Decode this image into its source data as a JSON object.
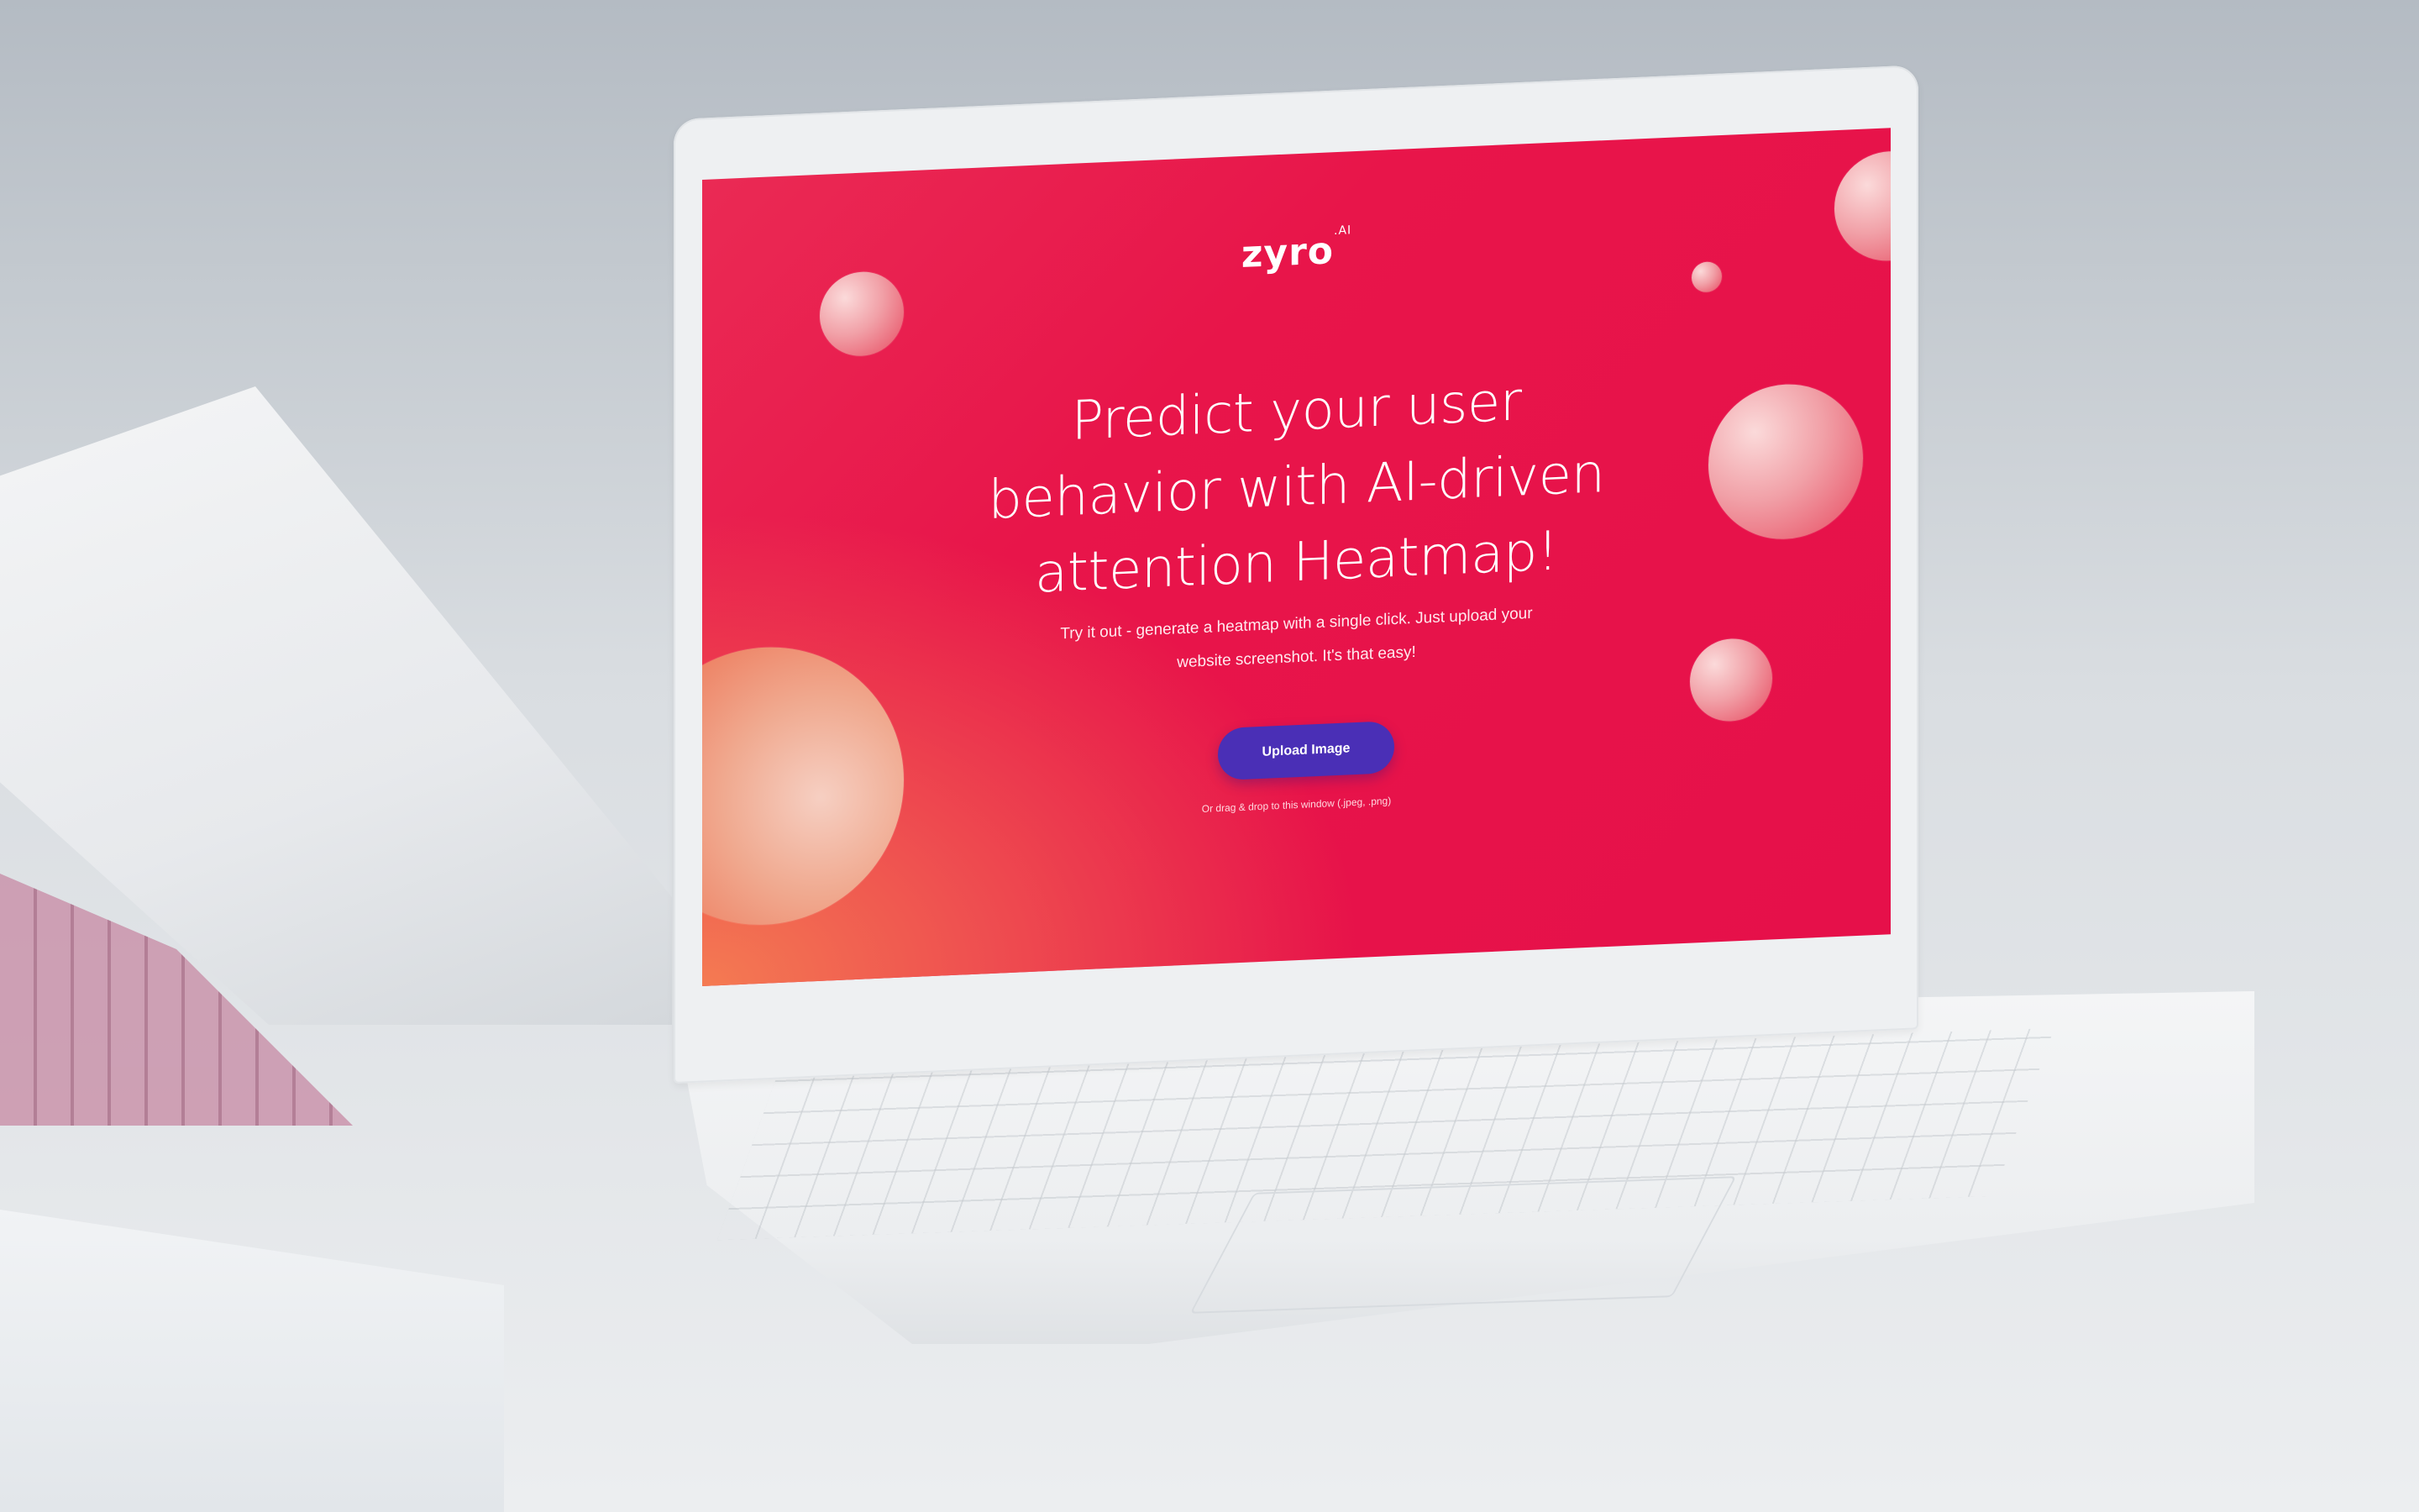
{
  "site": {
    "logo": "zyro",
    "logo_suffix": ".AI"
  },
  "hero": {
    "headline_lines": [
      "Predict your user",
      "behavior with AI-driven",
      "attention Heatmap!"
    ],
    "subtext_lines": [
      "Try it out - generate a heatmap with a single click. Just upload your",
      "website screenshot. It's that easy!"
    ],
    "upload_button": "Upload Image",
    "hint": "Or drag & drop to this window (.jpeg, .png)"
  },
  "colors": {
    "accent_red": "#e6104a",
    "button_purple": "#4a2fb6",
    "gradient_orange": "#f47b52"
  }
}
